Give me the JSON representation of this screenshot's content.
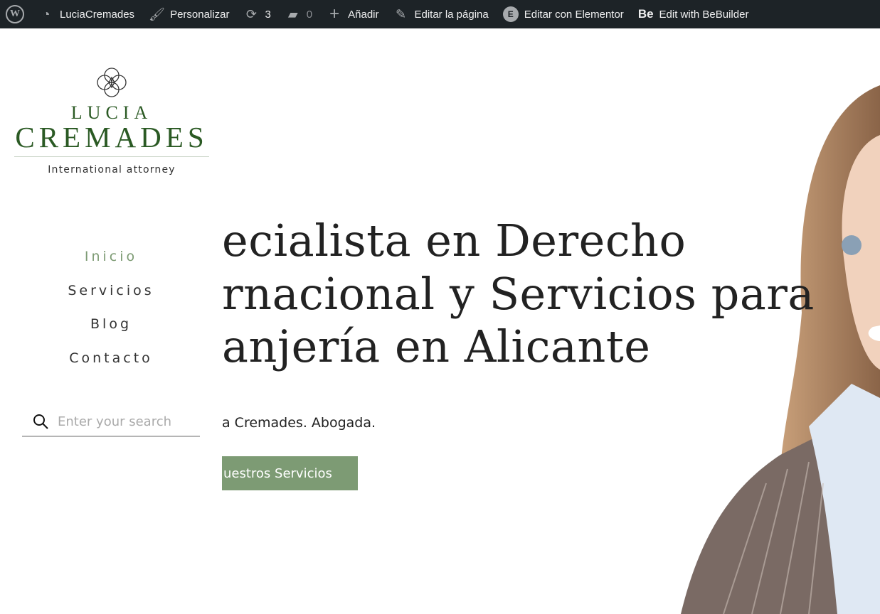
{
  "adminbar": {
    "site": "LuciaCremades",
    "customize": "Personalizar",
    "updates": "3",
    "comments": "0",
    "add": "Añadir",
    "edit_page": "Editar la página",
    "elementor": "Editar con Elementor",
    "bebuilder": "Edit with BeBuilder",
    "bebuilder_logo": "Be"
  },
  "logo": {
    "line1": "LUCIA",
    "line2": "CREMADES",
    "tagline": "International attorney"
  },
  "nav": [
    {
      "label": "Inicio",
      "active": true
    },
    {
      "label": "Servicios"
    },
    {
      "label": "Blog"
    },
    {
      "label": "Contacto"
    }
  ],
  "search": {
    "placeholder": "Enter your search"
  },
  "hero": {
    "lines": [
      "ecialista en Derecho",
      "rnacional y Servicios para",
      "anjería en Alicante"
    ],
    "subtitle": "a Cremades. Abogada.",
    "cta": "uestros Servicios"
  },
  "colors": {
    "accent": "#7d9b74",
    "brand": "#2b5a24",
    "adminbar": "#1d2327"
  }
}
